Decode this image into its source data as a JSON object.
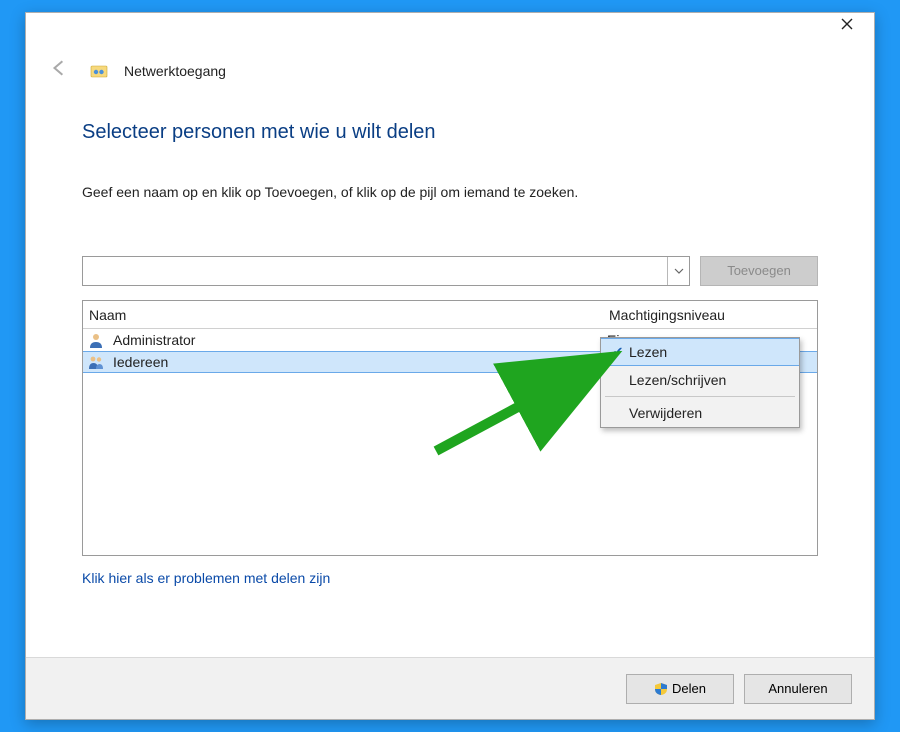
{
  "window": {
    "title": "Netwerktoegang"
  },
  "heading": "Selecteer personen met wie u wilt delen",
  "instruction": "Geef een naam op en klik op Toevoegen, of klik op de pijl om iemand te zoeken.",
  "add_button": "Toevoegen",
  "name_input_value": "",
  "columns": {
    "name": "Naam",
    "permission": "Machtigingsniveau"
  },
  "rows": [
    {
      "name": "Administrator",
      "permission": "Eigenaar",
      "icon": "user",
      "selected": false,
      "has_dropdown": false
    },
    {
      "name": "Iedereen",
      "permission": "Lezen",
      "icon": "group",
      "selected": true,
      "has_dropdown": true
    }
  ],
  "permission_menu": {
    "items": [
      {
        "label": "Lezen",
        "checked": true,
        "highlight": true
      },
      {
        "label": "Lezen/schrijven",
        "checked": false,
        "highlight": false
      }
    ],
    "remove_label": "Verwijderen"
  },
  "problems_link": "Klik hier als er problemen met delen zijn",
  "footer": {
    "share": "Delen",
    "cancel": "Annuleren"
  }
}
